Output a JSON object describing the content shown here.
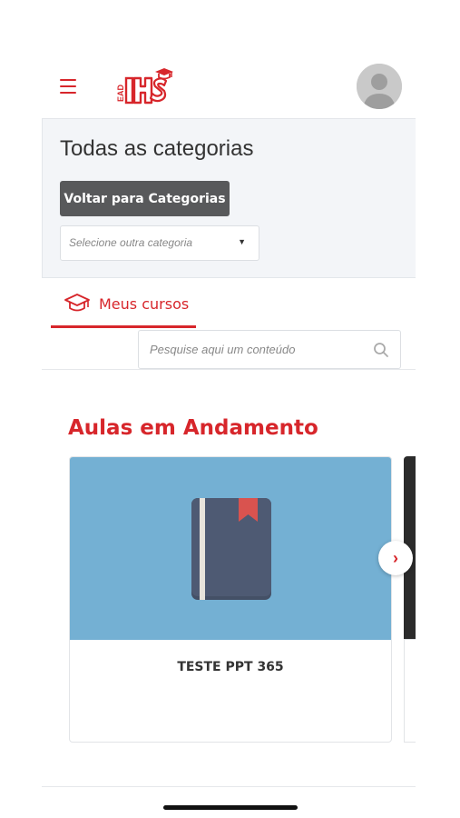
{
  "header": {
    "menu_icon": "hamburger-icon",
    "logo_text": "EAD IHS",
    "avatar_icon": "user-avatar-icon"
  },
  "categories": {
    "title": "Todas as categorias",
    "back_button_label": "Voltar para Categorias",
    "select_placeholder": "Selecione outra categoria",
    "select_caret": "▼"
  },
  "tabs": [
    {
      "label": "Meus cursos",
      "icon": "graduation-cap-icon",
      "active": true
    }
  ],
  "search": {
    "placeholder": "Pesquise aqui um conteúdo",
    "icon": "search-icon"
  },
  "section": {
    "title": "Aulas em Andamento"
  },
  "courses": [
    {
      "title": "TESTE PPT 365",
      "thumbnail_icon": "book-icon"
    }
  ],
  "carousel": {
    "next_symbol": "›"
  },
  "colors": {
    "accent": "#d7262b",
    "button_dark": "#58595b",
    "thumb_bg": "#74b0d3",
    "book_cover": "#4e5a73"
  }
}
